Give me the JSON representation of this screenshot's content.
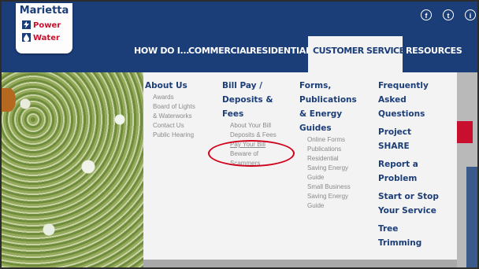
{
  "logo": {
    "line1": "Marietta",
    "line2": "Power",
    "line3": "Water"
  },
  "social": [
    "f",
    "t",
    "i"
  ],
  "nav": [
    {
      "label": "HOW DO I..."
    },
    {
      "label": "COMMERCIAL"
    },
    {
      "label": "RESIDENTIAL"
    },
    {
      "label": "CUSTOMER SERVICES"
    },
    {
      "label": "RESOURCES"
    }
  ],
  "columns": [
    {
      "heading": [
        "About Us"
      ],
      "items": [
        "Awards",
        "Board of Lights",
        "& Waterworks",
        "Contact Us",
        "Public Hearing"
      ]
    },
    {
      "heading": [
        "Bill Pay /",
        "Deposits &",
        "Fees"
      ],
      "items": [
        "About Your Bill",
        "Deposits & Fees",
        "Pay Your Bill",
        "Beware of",
        "Scammers"
      ]
    },
    {
      "heading": [
        "Forms,",
        "Publications",
        "& Energy",
        "Guides"
      ],
      "items": [
        "Online Forms",
        "Publications",
        "Residential",
        "Saving Energy",
        "Guide",
        "Small Business",
        "Saving Energy",
        "Guide"
      ]
    },
    {
      "heading": [
        "Frequently",
        "Asked",
        "Questions"
      ],
      "links": [
        [
          "Project",
          "SHARE"
        ],
        [
          "Report a",
          "Problem"
        ],
        [
          "Start or Stop",
          "Your Service"
        ],
        [
          "Tree",
          "Trimming"
        ]
      ]
    }
  ],
  "colors": {
    "navy": "#1b3d78",
    "highlight_circle": "#d0021b",
    "accent_red": "#c8102e"
  }
}
